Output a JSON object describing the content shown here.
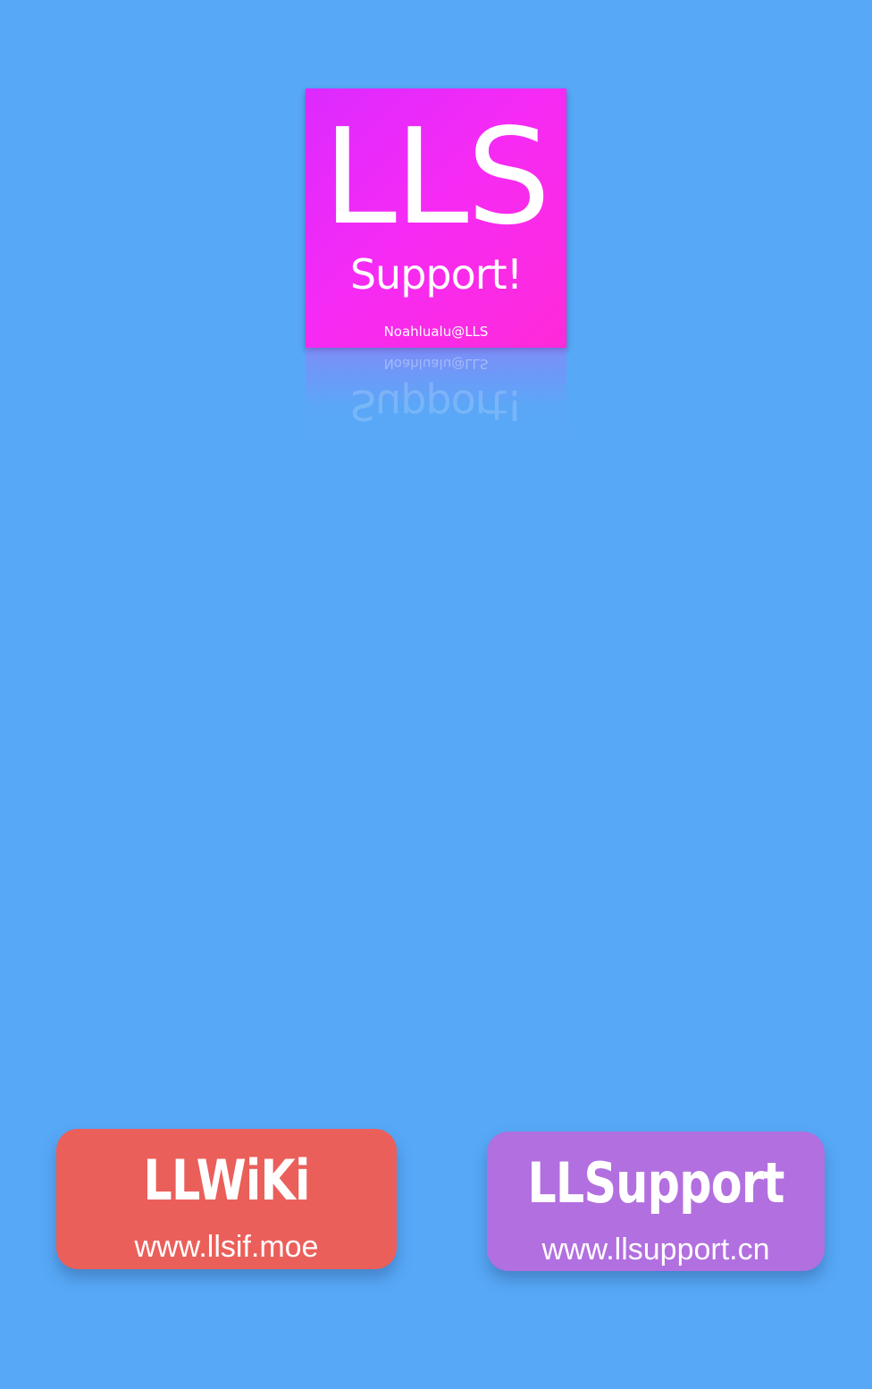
{
  "logo": {
    "title": "LLS",
    "subtitle": "Support!",
    "author": "Noahlualu@LLS"
  },
  "links": [
    {
      "title": "LLWiKi",
      "url": "www.llsif.moe",
      "color": "#eb5f5a"
    },
    {
      "title": "LLSupport",
      "url": "www.llsupport.cn",
      "color": "#b26fdf"
    }
  ],
  "colors": {
    "background": "#57a8f7",
    "logo_gradient_start": "#dc2aff",
    "logo_gradient_end": "#ff2ad8"
  }
}
